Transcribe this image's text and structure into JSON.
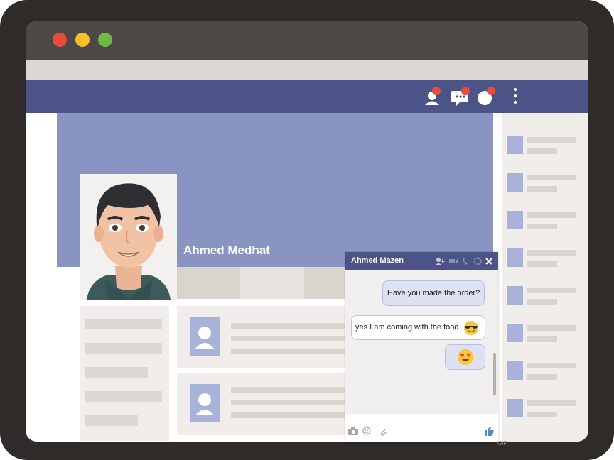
{
  "window": {
    "controls": [
      "close",
      "minimize",
      "maximize"
    ]
  },
  "colors": {
    "nav": "#4c5487",
    "cover": "#8994c2",
    "placeholder": "#a9b2d8",
    "badge": "#e84a3c"
  },
  "navbar": {
    "icons": [
      "friend-request-icon",
      "messages-icon",
      "notifications-icon",
      "more-menu-icon"
    ]
  },
  "profile": {
    "name": "Ahmed Medhat"
  },
  "chat": {
    "title": "Ahmed Mazen",
    "header_icons": [
      "add-person-icon",
      "video-call-icon",
      "phone-icon",
      "settings-icon",
      "close-icon"
    ],
    "messages": [
      {
        "side": "right",
        "text": "Have you made the order?"
      },
      {
        "side": "left",
        "text": "yes I am coming with the food",
        "emoji": "sunglasses-emoji"
      },
      {
        "side": "right",
        "text": "",
        "emoji": "heart-eyes-emoji"
      }
    ],
    "footer_icons": [
      "camera-icon",
      "emoji-icon",
      "attachment-icon",
      "like-icon"
    ],
    "gif_label": "GIF"
  }
}
